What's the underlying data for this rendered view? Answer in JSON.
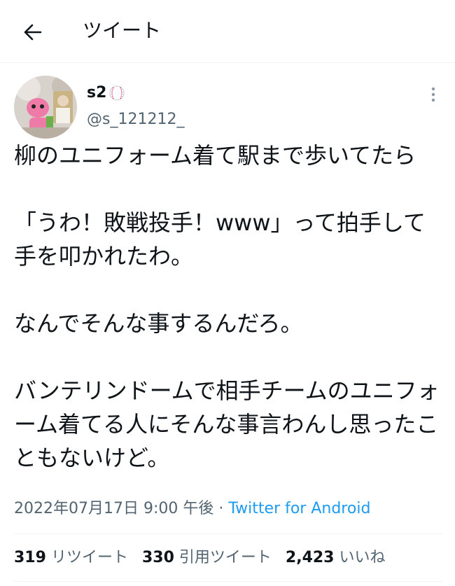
{
  "header": {
    "title": "ツイート"
  },
  "tweet": {
    "display_name": "s2",
    "handle": "@s_121212_",
    "text": "柳のユニフォーム着て駅まで歩いてたら\n\n「うわ！敗戦投手！www」って拍手して手を叩かれたわ。\n\nなんでそんな事するんだろ。\n\nバンテリンドームで相手チームのユニフォーム着てる人にそんな事言わんし思ったこともないけど。",
    "timestamp": "2022年07月17日 9:00 午後",
    "separator": "·",
    "client": "Twitter for Android"
  },
  "stats": {
    "retweets": {
      "count": "319",
      "label": "リツイート"
    },
    "quotes": {
      "count": "330",
      "label": "引用ツイート"
    },
    "likes": {
      "count": "2,423",
      "label": "いいね"
    }
  },
  "colors": {
    "link": "#1d9bf0",
    "secondary": "#536471",
    "text": "#0f1419"
  }
}
